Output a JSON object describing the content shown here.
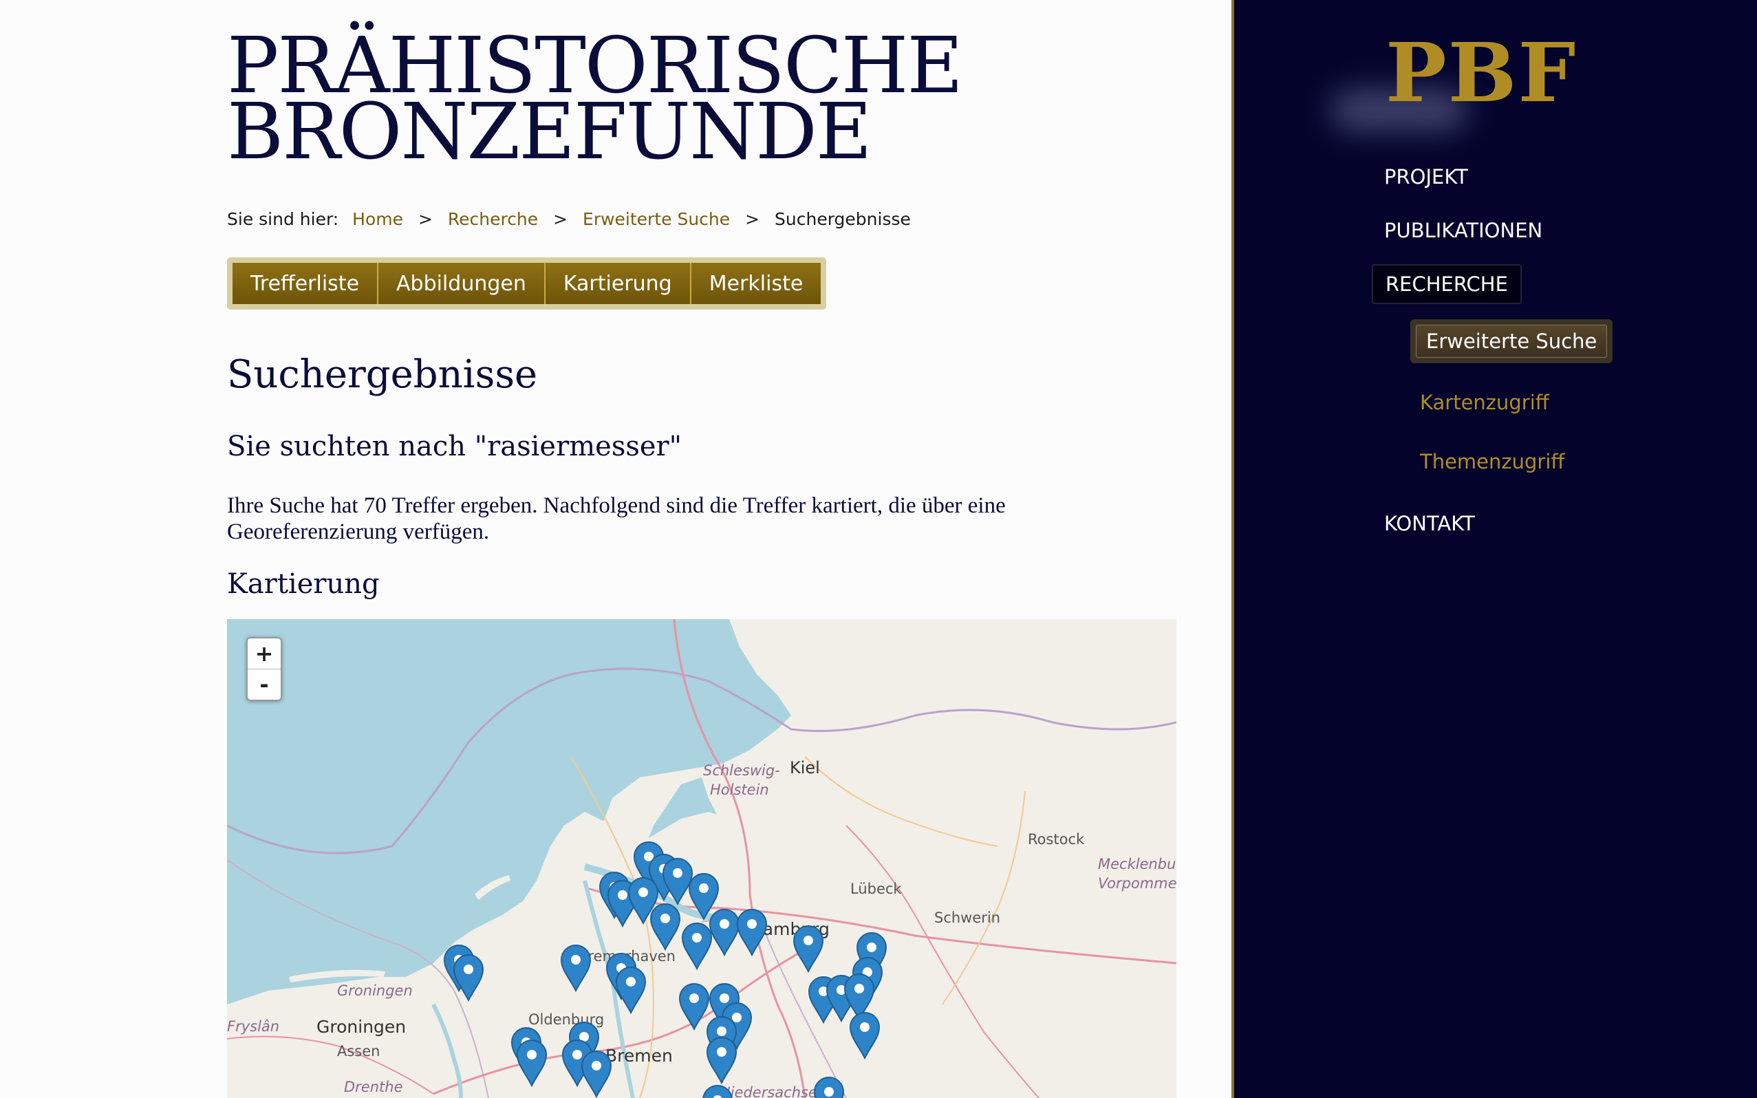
{
  "site": {
    "title_line1": "PRÄHISTORISCHE",
    "title_line2": "BRONZEFUNDE",
    "logo": "PBF"
  },
  "breadcrumb": {
    "prefix": "Sie sind hier:",
    "items": [
      "Home",
      "Recherche",
      "Erweiterte Suche"
    ],
    "current": "Suchergebnisse",
    "separator": ">"
  },
  "tabs": [
    "Trefferliste",
    "Abbildungen",
    "Kartierung",
    "Merkliste"
  ],
  "content": {
    "page_title": "Suchergebnisse",
    "search_heading": "Sie suchten nach \"rasiermesser\"",
    "result_text": "Ihre Suche hat 70 Treffer ergeben. Nachfolgend sind die Treffer kartiert, die über eine Georeferenzierung verfügen.",
    "map_heading": "Kartierung"
  },
  "map": {
    "zoom_in": "+",
    "zoom_out": "-",
    "labels": {
      "kiel": "Kiel",
      "schleswig_holstein_1": "Schleswig-",
      "schleswig_holstein_2": "Holstein",
      "rostock": "Rostock",
      "mecklenburg_1": "Mecklenburg",
      "mecklenburg_2": "Vorpommern",
      "luebeck": "Lübeck",
      "schwerin": "Schwerin",
      "hamburg": "Hamburg",
      "bremerhaven": "Bremerhaven",
      "groningen_region": "Groningen",
      "groningen": "Groningen",
      "friesland": "Fryslân",
      "oldenburg": "Oldenburg",
      "bremen": "Bremen",
      "assen": "Assen",
      "drenthe": "Drenthe",
      "niedersachsen": "Niedersachsen"
    },
    "colors": {
      "water": "#aad3df",
      "land": "#f2efe9",
      "marker": "#2e84c8"
    }
  },
  "sidebar": {
    "nav": [
      "PROJEKT",
      "PUBLIKATIONEN",
      "RECHERCHE",
      "KONTAKT"
    ],
    "active": "RECHERCHE",
    "subnav": [
      "Erweiterte Suche",
      "Kartenzugriff",
      "Themenzugriff"
    ],
    "active_sub": "Erweiterte Suche",
    "colors": {
      "background": "#03032c",
      "gold": "#b08d24"
    }
  }
}
